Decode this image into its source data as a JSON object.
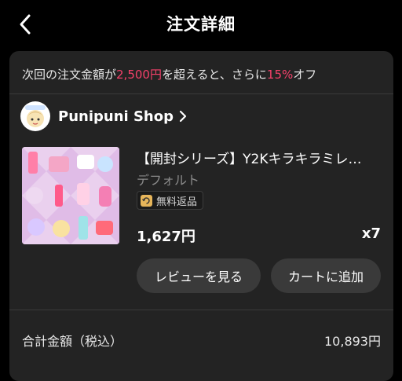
{
  "header": {
    "title": "注文詳細"
  },
  "promo": {
    "prefix": "次回の注文金額が",
    "amount": "2,500円",
    "middle": "を超えると、さらに",
    "discount": "15%",
    "suffix": "オフ"
  },
  "shop": {
    "name": "Punipuni Shop"
  },
  "product": {
    "title": "【開封シリーズ】Y2Kキラキラミレ…",
    "variant": "デフォルト",
    "badge": "無料返品",
    "price": "1,627円",
    "quantity": "x7"
  },
  "actions": {
    "review": "レビューを見る",
    "add_to_cart": "カートに追加"
  },
  "total": {
    "label": "合計金額（税込）",
    "value": "10,893円"
  },
  "colors": {
    "accent": "#f4416a",
    "card": "#232323",
    "button": "#3a3a3a"
  },
  "icons": [
    "back-chevron-icon",
    "chevron-right-icon",
    "return-icon"
  ]
}
